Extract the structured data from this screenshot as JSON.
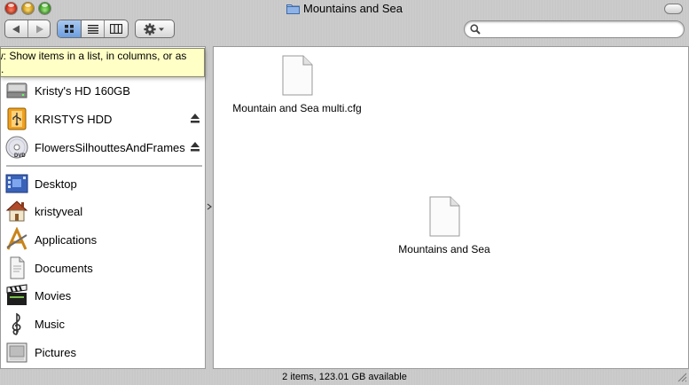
{
  "window": {
    "title": "Mountains and Sea"
  },
  "toolbar": {
    "back_icon": "back-arrow-icon",
    "forward_icon": "forward-arrow-icon",
    "view_modes": [
      "icon-view-icon",
      "list-view-icon",
      "column-view-icon"
    ],
    "selected_view": "icon-view-icon",
    "action_icon": "gear-icon"
  },
  "search": {
    "value": "",
    "placeholder": ""
  },
  "tooltip": {
    "line1": "w: Show items in a list, in columns, or as",
    "line2": "s."
  },
  "sidebar": {
    "devices": [
      {
        "label": "Kristy's HD 160GB",
        "icon": "hard-drive-icon",
        "eject": false
      },
      {
        "label": "KRISTYS HDD",
        "icon": "usb-drive-icon",
        "eject": true
      },
      {
        "label": "FlowersSilhouttesAndFrames",
        "icon": "dvd-icon",
        "eject": true
      }
    ],
    "places": [
      {
        "label": "Desktop",
        "icon": "desktop-icon"
      },
      {
        "label": "kristyveal",
        "icon": "home-icon"
      },
      {
        "label": "Applications",
        "icon": "applications-icon"
      },
      {
        "label": "Documents",
        "icon": "documents-icon"
      },
      {
        "label": "Movies",
        "icon": "movies-icon"
      },
      {
        "label": "Music",
        "icon": "music-icon"
      },
      {
        "label": "Pictures",
        "icon": "pictures-icon"
      }
    ]
  },
  "files": [
    {
      "name": "Mountain and Sea multi.cfg",
      "icon": "document-icon"
    },
    {
      "name": "Mountains and Sea",
      "icon": "document-icon"
    }
  ],
  "status": {
    "text": "2 items, 123.01 GB available"
  },
  "colors": {
    "selected_view": "#7aa8e6",
    "tooltip_bg": "#ffffc6"
  }
}
